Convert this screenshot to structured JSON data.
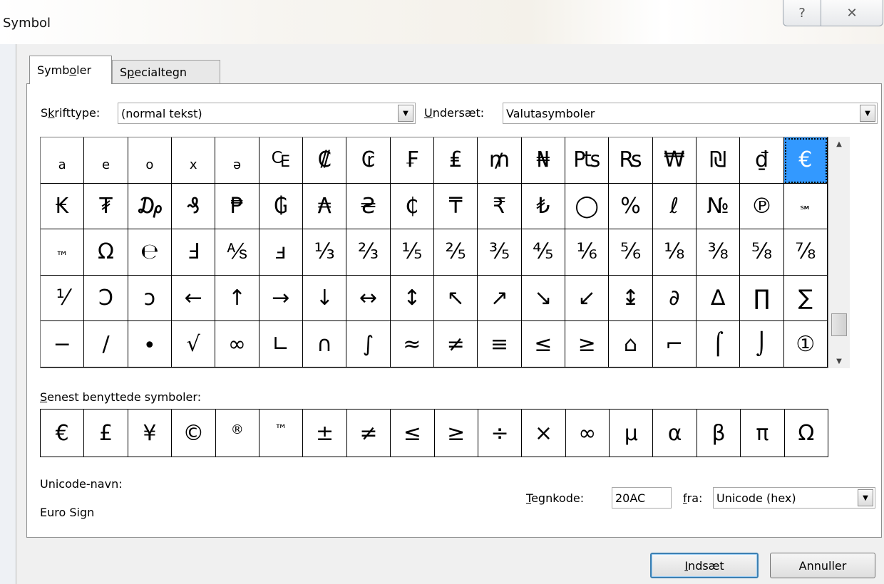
{
  "window": {
    "title": "Symbol",
    "help_glyph": "?",
    "close_glyph": "✕"
  },
  "tabs": [
    {
      "label_pre": "Symb",
      "label_acc": "o",
      "label_post": "ler"
    },
    {
      "label_pre": "S",
      "label_acc": "p",
      "label_post": "ecialtegn"
    }
  ],
  "font_row": {
    "label_pre": "S",
    "label_acc": "k",
    "label_post": "rifttype:",
    "value": "(normal tekst)"
  },
  "subset_row": {
    "label_pre": "",
    "label_acc": "U",
    "label_post": "ndersæt:",
    "value": "Valutasymboler"
  },
  "symbol_grid": {
    "selected_index": 17,
    "rows": [
      [
        "a",
        "e",
        "o",
        "x",
        "ə",
        "₠",
        "₡",
        "₢",
        "₣",
        "₤",
        "₥",
        "₦",
        "₧",
        "₨",
        "₩",
        "₪",
        "₫",
        "€"
      ],
      [
        "₭",
        "₮",
        "₯",
        "₰",
        "₱",
        "₲",
        "₳",
        "₴",
        "₵",
        "₸",
        "₹",
        "₺",
        "◯",
        "%",
        "ℓ",
        "№",
        "℗",
        "℠"
      ],
      [
        "™",
        "Ω",
        "℮",
        "Ⅎ",
        "⅍",
        "ⅎ",
        "⅓",
        "⅔",
        "⅕",
        "⅖",
        "⅗",
        "⅘",
        "⅙",
        "⅚",
        "⅛",
        "⅜",
        "⅝",
        "⅞"
      ],
      [
        "⅟",
        "Ↄ",
        "ↄ",
        "←",
        "↑",
        "→",
        "↓",
        "↔",
        "↕",
        "↖",
        "↗",
        "↘",
        "↙",
        "↨",
        "∂",
        "∆",
        "∏",
        "∑"
      ],
      [
        "−",
        "∕",
        "∙",
        "√",
        "∞",
        "∟",
        "∩",
        "∫",
        "≈",
        "≠",
        "≡",
        "≤",
        "≥",
        "⌂",
        "⌐",
        "⌠",
        "⌡",
        "①"
      ]
    ],
    "small_glyphs": [
      "a",
      "e",
      "o",
      "x",
      "ə",
      "℠",
      "™"
    ]
  },
  "scrollbar": {
    "up": "▲",
    "down": "▼"
  },
  "recent": {
    "label_pre": "",
    "label_acc": "S",
    "label_post": "enest benyttede symboler:",
    "symbols": [
      "€",
      "£",
      "¥",
      "©",
      "®",
      "™",
      "±",
      "≠",
      "≤",
      "≥",
      "÷",
      "×",
      "∞",
      "µ",
      "α",
      "β",
      "π",
      "Ω"
    ],
    "small_glyphs": [
      "®",
      "™"
    ]
  },
  "unicode": {
    "name_label": "Unicode-navn:",
    "name_value": "Euro Sign"
  },
  "charcode": {
    "label_pre": "",
    "label_acc": "T",
    "label_post": "egnkode:",
    "value": "20AC"
  },
  "from": {
    "label_pre": "",
    "label_acc": "f",
    "label_post": "ra:",
    "value": "Unicode (hex)"
  },
  "buttons": {
    "insert": {
      "label_pre": "",
      "label_acc": "I",
      "label_post": "ndsæt"
    },
    "cancel": {
      "label": "Annuller"
    }
  },
  "combo_arrow": "▼"
}
